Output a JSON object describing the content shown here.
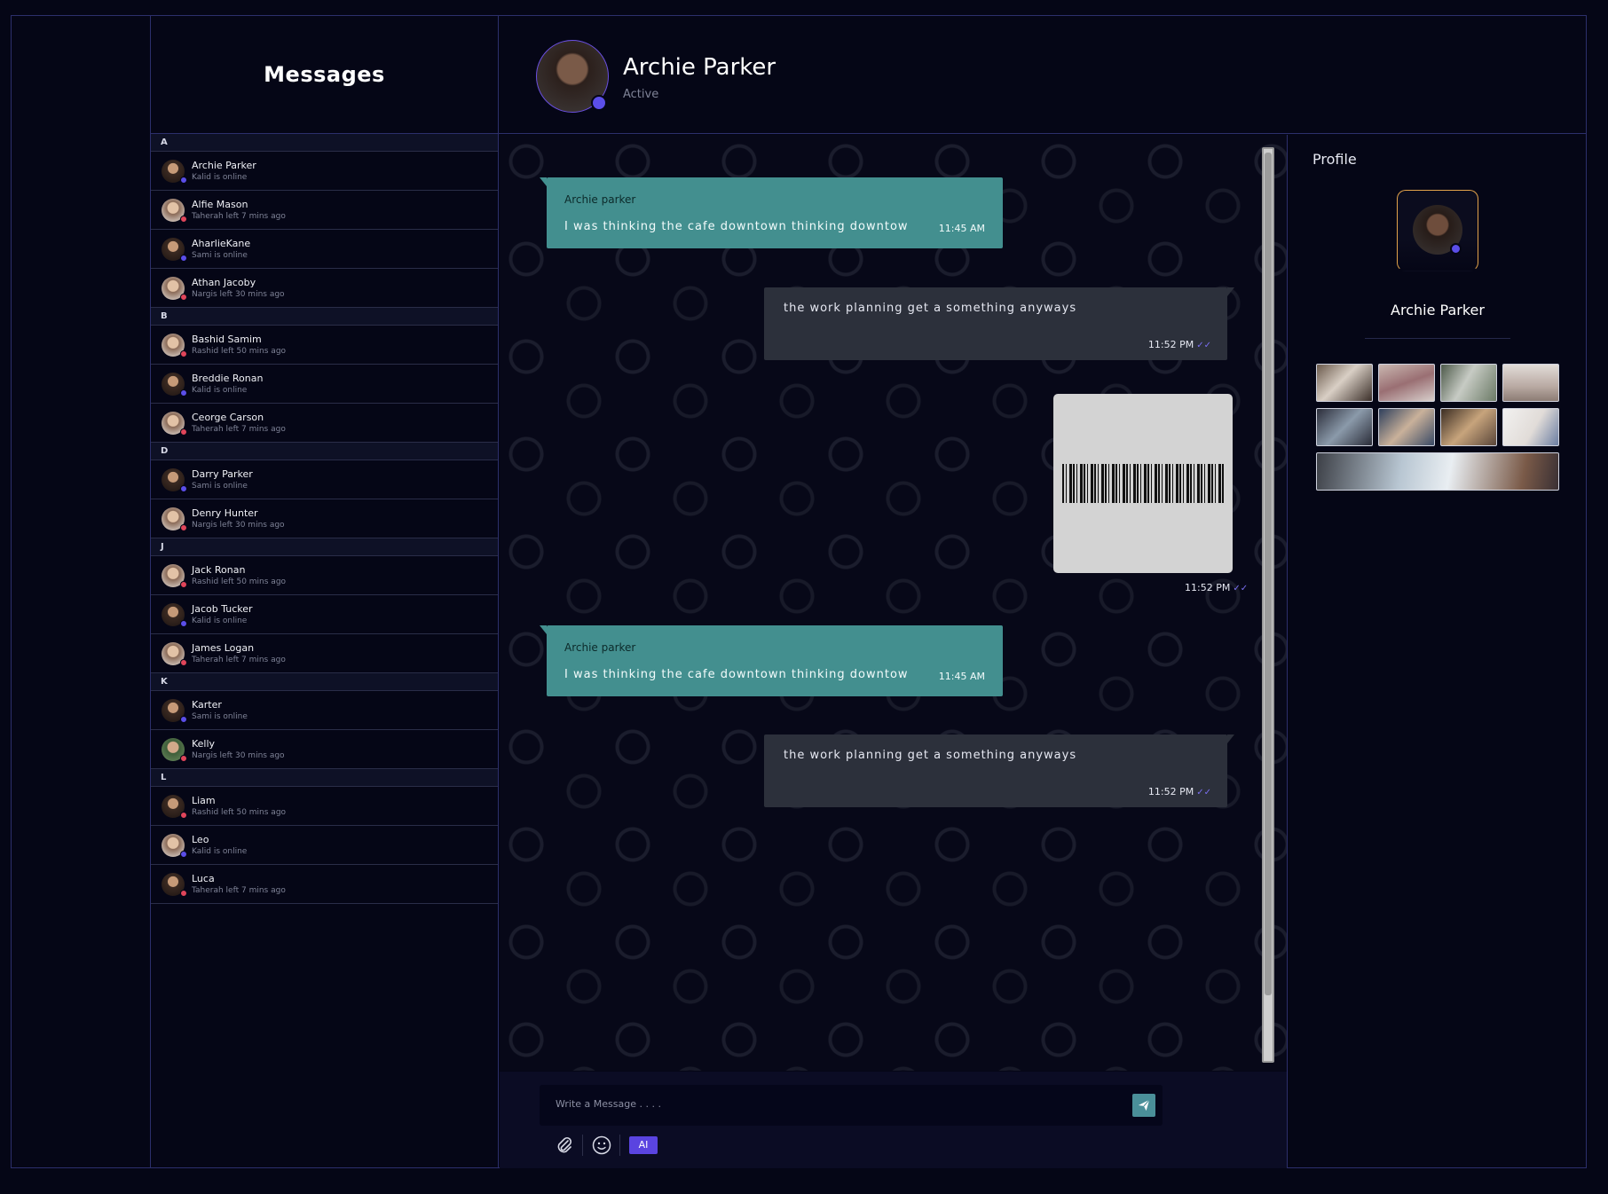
{
  "contacts_panel": {
    "title": "Messages",
    "groups": [
      {
        "letter": "A",
        "contacts": [
          {
            "name": "Archie Parker",
            "status": "Kalid is online",
            "online": true
          },
          {
            "name": "Alfie Mason",
            "status": "Taherah left 7 mins ago",
            "online": false
          },
          {
            "name": "AharlieKane",
            "status": "Sami is online",
            "online": true
          },
          {
            "name": "Athan Jacoby",
            "status": "Nargis left 30 mins ago",
            "online": false
          }
        ]
      },
      {
        "letter": "B",
        "contacts": [
          {
            "name": "Bashid Samim",
            "status": "Rashid left 50 mins ago",
            "online": false
          },
          {
            "name": "Breddie Ronan",
            "status": "Kalid is online",
            "online": true
          },
          {
            "name": "Ceorge Carson",
            "status": "Taherah left 7 mins ago",
            "online": false
          }
        ]
      },
      {
        "letter": "D",
        "contacts": [
          {
            "name": "Darry Parker",
            "status": "Sami is online",
            "online": true
          },
          {
            "name": "Denry Hunter",
            "status": "Nargis left 30 mins ago",
            "online": false
          }
        ]
      },
      {
        "letter": "J",
        "contacts": [
          {
            "name": "Jack Ronan",
            "status": "Rashid left 50 mins ago",
            "online": false
          },
          {
            "name": "Jacob Tucker",
            "status": "Kalid is online",
            "online": true
          },
          {
            "name": "James Logan",
            "status": "Taherah left 7 mins ago",
            "online": false
          }
        ]
      },
      {
        "letter": "K",
        "contacts": [
          {
            "name": "Karter",
            "status": "Sami is online",
            "online": true
          },
          {
            "name": "Kelly",
            "status": "Nargis left 30 mins ago",
            "online": false
          }
        ]
      },
      {
        "letter": "L",
        "contacts": [
          {
            "name": "Liam",
            "status": "Rashid left 50 mins ago",
            "online": false
          },
          {
            "name": "Leo",
            "status": "Kalid is online",
            "online": true
          },
          {
            "name": "Luca",
            "status": "Taherah left 7 mins ago",
            "online": false
          }
        ]
      }
    ]
  },
  "chat_header": {
    "name": "Archie Parker",
    "status": "Active"
  },
  "messages": [
    {
      "direction": "in",
      "sender": "Archie parker",
      "text": "I was thinking the cafe downtown thinking downtow",
      "time": "11:45 AM"
    },
    {
      "direction": "out",
      "text": "the work planning get a something anyways",
      "time": "11:52 PM"
    },
    {
      "direction": "out",
      "type": "image",
      "image": "barcode",
      "time": "11:52 PM"
    },
    {
      "direction": "in",
      "sender": "Archie parker",
      "text": "I was thinking the cafe downtown thinking downtow",
      "time": "11:45 AM"
    },
    {
      "direction": "out",
      "text": "the work planning get a something anyways",
      "time": "11:52 PM"
    }
  ],
  "composer": {
    "placeholder": "Write a Message . . . .",
    "ai_label": "AI"
  },
  "profile": {
    "title": "Profile",
    "name": "Archie Parker",
    "media_count": 9
  },
  "colors": {
    "background": "#050616",
    "border": "#2c2f6b",
    "incoming_bubble": "#438f8f",
    "outgoing_bubble": "#2c303b",
    "online_dot": "#5b4ee8",
    "offline_dot": "#e0455a",
    "ai_button": "#5a44e0",
    "send_button": "#4a8f99"
  }
}
